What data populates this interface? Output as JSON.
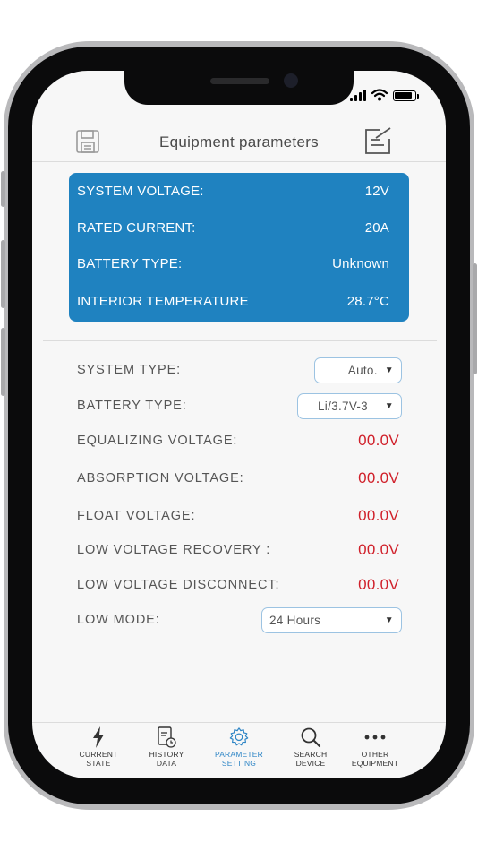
{
  "header": {
    "title": "Equipment parameters"
  },
  "info": [
    {
      "label": "SYSTEM VOLTAGE:",
      "value": "12V"
    },
    {
      "label": "RATED CURRENT:",
      "value": "20A"
    },
    {
      "label": "BATTERY TYPE:",
      "value": "Unknown"
    },
    {
      "label": "INTERIOR TEMPERATURE",
      "value": "28.7°C"
    }
  ],
  "params": {
    "system_type": {
      "label": "SYSTEM  TYPE:",
      "value": "Auto."
    },
    "battery_type": {
      "label": "BATTERY  TYPE:",
      "value": "Li/3.7V-3"
    },
    "equalizing": {
      "label": "EQUALIZING  VOLTAGE:",
      "value": "00.0V"
    },
    "absorption": {
      "label": "ABSORPTION  VOLTAGE:",
      "value": "00.0V"
    },
    "float": {
      "label": "FLOAT  VOLTAGE:",
      "value": "00.0V"
    },
    "lv_recovery": {
      "label": "LOW VOLTAGE RECOVERY :",
      "value": "00.0V"
    },
    "lv_disconnect": {
      "label": "LOW VOLTAGE DISCONNECT:",
      "value": "00.0V"
    },
    "low_mode": {
      "label": "LOW MODE:",
      "value": "24 Hours"
    }
  },
  "tabs": [
    {
      "line1": "CURRENT",
      "line2": "STATE"
    },
    {
      "line1": "HISTORY",
      "line2": "DATA"
    },
    {
      "line1": "PARAMETER",
      "line2": "SETTING"
    },
    {
      "line1": "SEARCH",
      "line2": "DEVICE"
    },
    {
      "line1": "OTHER",
      "line2": "EQUIPMENT"
    }
  ],
  "colors": {
    "accent": "#1f82c0",
    "value_red": "#d0202a",
    "tab_active": "#2f86c6"
  },
  "icons": [
    "save-icon",
    "edit-icon",
    "lightning-icon",
    "document-clock-icon",
    "gear-icon",
    "search-icon",
    "more-dots-icon",
    "signal-icon",
    "wifi-icon",
    "battery-icon"
  ]
}
